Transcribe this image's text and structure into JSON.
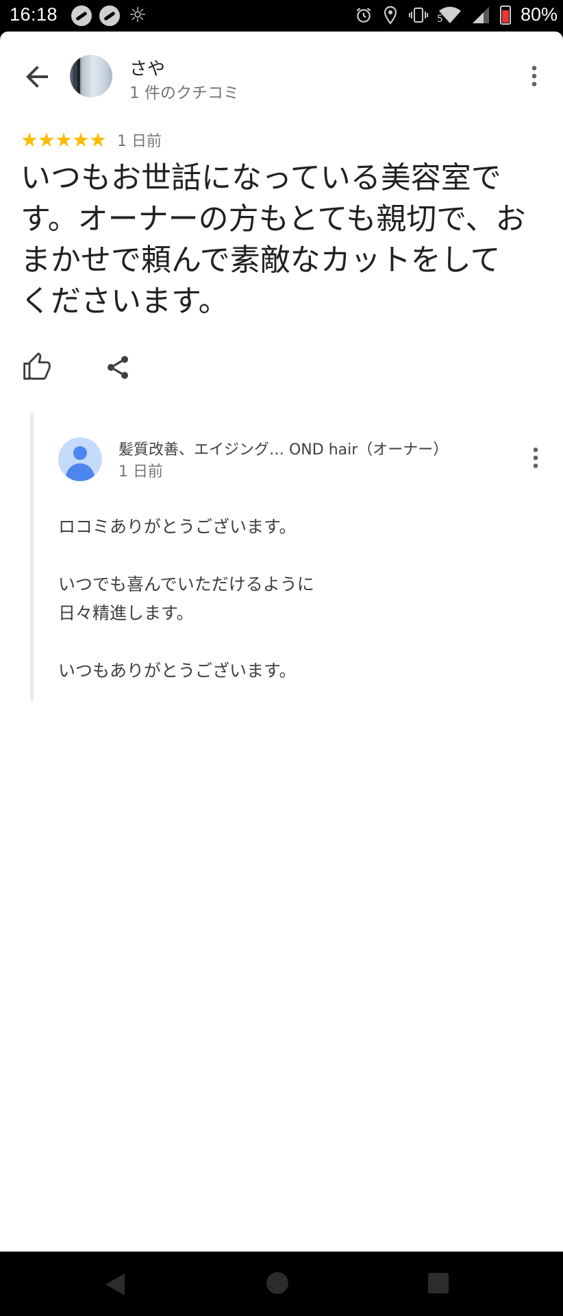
{
  "status_bar": {
    "time": "16:18",
    "battery_percent": "80%",
    "network_label": "5",
    "icons": [
      "app-icon",
      "app-icon",
      "brightness-icon",
      "alarm-icon",
      "location-icon",
      "vibrate-icon",
      "wifi-icon",
      "signal-icon",
      "battery-icon"
    ]
  },
  "header": {
    "reviewer_name": "さや",
    "reviewer_meta": "1 件のクチコミ"
  },
  "review": {
    "stars": "★★★★★",
    "rating": 5,
    "date": "1 日前",
    "text": "いつもお世話になっている美容室です。オーナーの方もとても親切で、おまかせで頼んで素敵なカットをしてくださいます。"
  },
  "reply": {
    "owner_name": "髪質改善、エイジング… OND hair（オーナー）",
    "date": "1 日前",
    "line1": "ロコミありがとうございます。",
    "line2": "いつでも喜んでいただけるように",
    "line3": "日々精進します。",
    "line4": "いつもありがとうございます。"
  },
  "colors": {
    "star": "#fbbc04",
    "owner_avatar_bg": "#c6dafc",
    "owner_avatar_fg": "#4e86f0"
  }
}
